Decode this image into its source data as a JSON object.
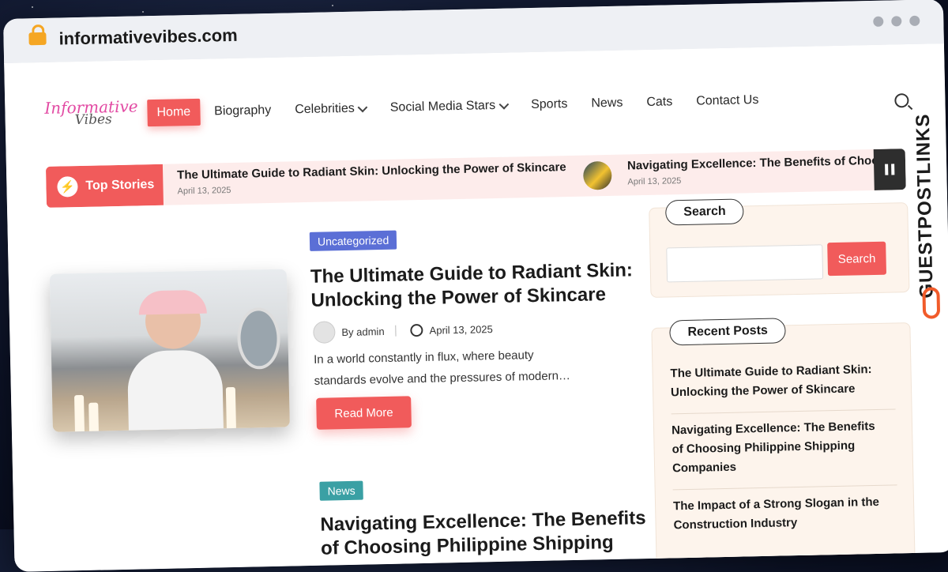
{
  "browser": {
    "url": "informativevibes.com"
  },
  "logo": {
    "line1": "Informative",
    "line2": "Vibes"
  },
  "nav": {
    "items": [
      {
        "label": "Home"
      },
      {
        "label": "Biography"
      },
      {
        "label": "Celebrities"
      },
      {
        "label": "Social Media Stars"
      },
      {
        "label": "Sports"
      },
      {
        "label": "News"
      },
      {
        "label": "Cats"
      },
      {
        "label": "Contact Us"
      }
    ]
  },
  "ticker": {
    "label": "Top Stories",
    "items": [
      {
        "title": "The Ultimate Guide to Radiant Skin: Unlocking the Power of Skincare",
        "date": "April 13, 2025"
      },
      {
        "title": "Navigating Excellence: The Benefits of Choo",
        "date": "April 13, 2025"
      }
    ]
  },
  "posts": [
    {
      "category": "Uncategorized",
      "title_line1": "The Ultimate Guide to Radiant Skin:",
      "title_line2": "Unlocking the Power of Skincare",
      "author": "By admin",
      "date": "April 13, 2025",
      "excerpt_line1": "In a world constantly in flux, where beauty",
      "excerpt_line2": "standards evolve and the pressures of modern…",
      "read_more": "Read More"
    },
    {
      "category": "News",
      "title_line1": "Navigating Excellence: The Benefits",
      "title_line2": "of Choosing Philippine Shipping"
    }
  ],
  "sidebar": {
    "search": {
      "title": "Search",
      "button": "Search",
      "placeholder": ""
    },
    "recent": {
      "title": "Recent Posts",
      "items": [
        {
          "line1": "The Ultimate Guide to Radiant Skin:",
          "line2": "Unlocking the Power of Skincare"
        },
        {
          "line1": "Navigating Excellence: The Benefits",
          "line2": "of Choosing Philippine Shipping",
          "line3": "Companies"
        },
        {
          "line1": "The Impact of a Strong Slogan in the",
          "line2": "Construction Industry"
        }
      ]
    }
  },
  "watermark": {
    "text": "GUESTPOSTLINKS"
  },
  "colors": {
    "accent": "#f15b5b",
    "uncategorized_badge": "#5b6fd6",
    "news_badge": "#3aa0a4"
  }
}
